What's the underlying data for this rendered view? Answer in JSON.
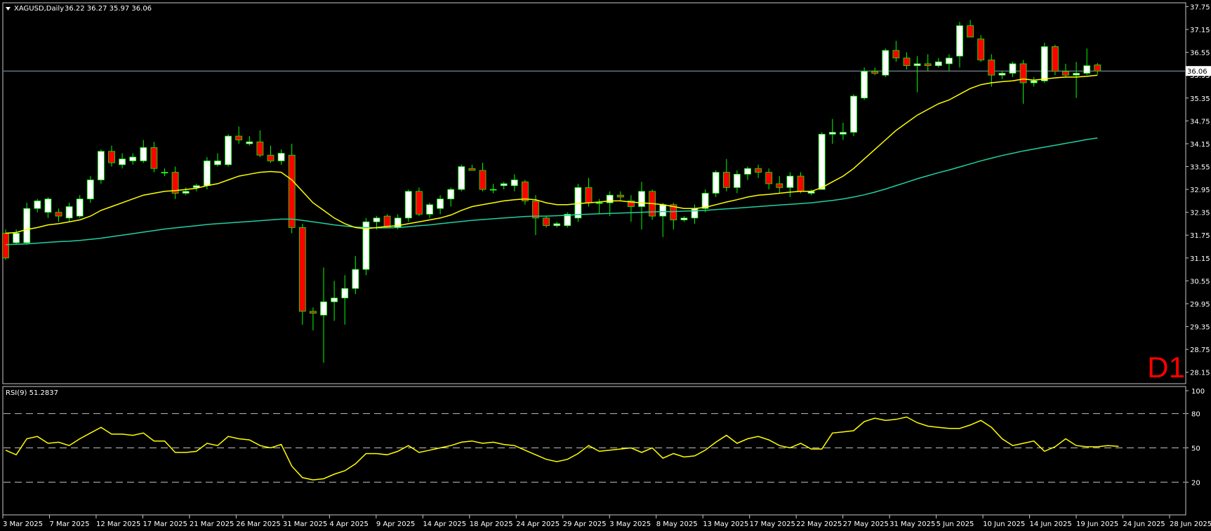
{
  "header": {
    "symbol_label": "XAGUSD,Daily",
    "ohlc_label": "36.22 36.27 35.97 36.06"
  },
  "timeframe_label": "D1",
  "current_price_label": "36.06",
  "rsi_header": "RSI(9) 51.2837",
  "colors": {
    "background": "#000000",
    "frame": "#c8c8c8",
    "bull_fill": "#ffffff",
    "bear_fill": "#ff0000",
    "wick": "#00ff00",
    "ma_fast": "#ffff00",
    "ma_slow": "#20d0a0",
    "rsi_line": "#ffff00",
    "level_line": "#bfbfbf",
    "price_line": "#8fa3b5",
    "timeframe": "#ff0000"
  },
  "chart_data": [
    {
      "type": "candlestick",
      "title": "XAGUSD,Daily",
      "ylim": [
        27.85,
        37.85
      ],
      "y_ticks": [
        "37.75",
        "37.15",
        "36.55",
        "35.95",
        "35.35",
        "34.75",
        "34.15",
        "33.55",
        "32.95",
        "32.35",
        "31.75",
        "31.15",
        "30.55",
        "29.95",
        "29.35",
        "28.75",
        "28.15"
      ],
      "x_tick_labels": [
        "3 Mar 2025",
        "7 Mar 2025",
        "12 Mar 2025",
        "17 Mar 2025",
        "21 Mar 2025",
        "26 Mar 2025",
        "31 Mar 2025",
        "4 Apr 2025",
        "9 Apr 2025",
        "14 Apr 2025",
        "18 Apr 2025",
        "24 Apr 2025",
        "29 Apr 2025",
        "3 May 2025",
        "8 May 2025",
        "13 May 2025",
        "17 May 2025",
        "22 May 2025",
        "27 May 2025",
        "31 May 2025",
        "5 Jun 2025",
        "10 Jun 2025",
        "14 Jun 2025",
        "19 Jun 2025",
        "24 Jun 2025",
        "28 Jun 2025"
      ],
      "current_price": 36.06,
      "candles": [
        {
          "o": 31.8,
          "h": 31.9,
          "l": 31.1,
          "c": 31.15
        },
        {
          "o": 31.55,
          "h": 31.9,
          "l": 31.5,
          "c": 31.8
        },
        {
          "o": 31.55,
          "h": 32.6,
          "l": 31.5,
          "c": 32.45
        },
        {
          "o": 32.45,
          "h": 32.7,
          "l": 32.35,
          "c": 32.65
        },
        {
          "o": 32.35,
          "h": 32.75,
          "l": 32.2,
          "c": 32.7
        },
        {
          "o": 32.35,
          "h": 32.45,
          "l": 32.1,
          "c": 32.25
        },
        {
          "o": 32.2,
          "h": 32.6,
          "l": 32.1,
          "c": 32.5
        },
        {
          "o": 32.25,
          "h": 32.8,
          "l": 32.2,
          "c": 32.7
        },
        {
          "o": 32.7,
          "h": 33.3,
          "l": 32.6,
          "c": 33.2
        },
        {
          "o": 33.2,
          "h": 34.0,
          "l": 33.1,
          "c": 33.95
        },
        {
          "o": 33.95,
          "h": 34.1,
          "l": 33.55,
          "c": 33.65
        },
        {
          "o": 33.6,
          "h": 33.9,
          "l": 33.5,
          "c": 33.75
        },
        {
          "o": 33.7,
          "h": 33.9,
          "l": 33.6,
          "c": 33.8
        },
        {
          "o": 33.7,
          "h": 34.25,
          "l": 33.65,
          "c": 34.05
        },
        {
          "o": 34.05,
          "h": 34.2,
          "l": 33.4,
          "c": 33.5
        },
        {
          "o": 33.4,
          "h": 33.5,
          "l": 33.3,
          "c": 33.4
        },
        {
          "o": 33.4,
          "h": 33.55,
          "l": 32.7,
          "c": 32.85
        },
        {
          "o": 32.85,
          "h": 33.0,
          "l": 32.8,
          "c": 32.9
        },
        {
          "o": 33.0,
          "h": 33.1,
          "l": 32.9,
          "c": 33.05
        },
        {
          "o": 33.05,
          "h": 33.8,
          "l": 32.95,
          "c": 33.7
        },
        {
          "o": 33.6,
          "h": 33.9,
          "l": 33.55,
          "c": 33.7
        },
        {
          "o": 33.6,
          "h": 34.4,
          "l": 33.55,
          "c": 34.35
        },
        {
          "o": 34.35,
          "h": 34.6,
          "l": 34.15,
          "c": 34.25
        },
        {
          "o": 34.15,
          "h": 34.35,
          "l": 34.1,
          "c": 34.2
        },
        {
          "o": 34.2,
          "h": 34.5,
          "l": 33.8,
          "c": 33.85
        },
        {
          "o": 33.85,
          "h": 34.1,
          "l": 33.65,
          "c": 33.7
        },
        {
          "o": 33.7,
          "h": 34.0,
          "l": 33.6,
          "c": 33.9
        },
        {
          "o": 33.85,
          "h": 34.15,
          "l": 31.8,
          "c": 31.95
        },
        {
          "o": 31.95,
          "h": 32.05,
          "l": 29.4,
          "c": 29.75
        },
        {
          "o": 29.75,
          "h": 29.85,
          "l": 29.25,
          "c": 29.7
        },
        {
          "o": 29.65,
          "h": 30.9,
          "l": 28.4,
          "c": 30.0
        },
        {
          "o": 30.0,
          "h": 30.55,
          "l": 29.5,
          "c": 30.1
        },
        {
          "o": 30.1,
          "h": 30.7,
          "l": 29.4,
          "c": 30.35
        },
        {
          "o": 30.35,
          "h": 31.2,
          "l": 30.2,
          "c": 30.85
        },
        {
          "o": 30.85,
          "h": 32.2,
          "l": 30.7,
          "c": 32.1
        },
        {
          "o": 32.1,
          "h": 32.25,
          "l": 31.9,
          "c": 32.2
        },
        {
          "o": 32.25,
          "h": 32.3,
          "l": 31.95,
          "c": 31.95
        },
        {
          "o": 31.95,
          "h": 32.3,
          "l": 31.9,
          "c": 32.2
        },
        {
          "o": 32.2,
          "h": 32.95,
          "l": 32.1,
          "c": 32.9
        },
        {
          "o": 32.9,
          "h": 33.0,
          "l": 32.25,
          "c": 32.3
        },
        {
          "o": 32.3,
          "h": 32.6,
          "l": 32.2,
          "c": 32.55
        },
        {
          "o": 32.45,
          "h": 32.8,
          "l": 32.3,
          "c": 32.7
        },
        {
          "o": 32.7,
          "h": 33.0,
          "l": 32.5,
          "c": 32.95
        },
        {
          "o": 32.95,
          "h": 33.6,
          "l": 32.9,
          "c": 33.55
        },
        {
          "o": 33.5,
          "h": 33.6,
          "l": 33.45,
          "c": 33.45
        },
        {
          "o": 33.45,
          "h": 33.65,
          "l": 32.9,
          "c": 32.95
        },
        {
          "o": 32.95,
          "h": 33.1,
          "l": 32.85,
          "c": 32.95
        },
        {
          "o": 33.05,
          "h": 33.15,
          "l": 32.95,
          "c": 33.1
        },
        {
          "o": 33.05,
          "h": 33.35,
          "l": 32.9,
          "c": 33.2
        },
        {
          "o": 33.15,
          "h": 33.2,
          "l": 32.55,
          "c": 32.65
        },
        {
          "o": 32.65,
          "h": 32.8,
          "l": 31.75,
          "c": 32.2
        },
        {
          "o": 32.2,
          "h": 32.25,
          "l": 31.95,
          "c": 32.0
        },
        {
          "o": 32.0,
          "h": 32.1,
          "l": 31.95,
          "c": 32.05
        },
        {
          "o": 32.0,
          "h": 32.35,
          "l": 31.95,
          "c": 32.3
        },
        {
          "o": 32.2,
          "h": 33.1,
          "l": 32.1,
          "c": 33.0
        },
        {
          "o": 33.0,
          "h": 33.25,
          "l": 32.5,
          "c": 32.6
        },
        {
          "o": 32.6,
          "h": 32.7,
          "l": 32.3,
          "c": 32.6
        },
        {
          "o": 32.6,
          "h": 32.9,
          "l": 32.25,
          "c": 32.8
        },
        {
          "o": 32.8,
          "h": 32.9,
          "l": 32.65,
          "c": 32.75
        },
        {
          "o": 32.65,
          "h": 32.8,
          "l": 32.1,
          "c": 32.5
        },
        {
          "o": 32.5,
          "h": 33.15,
          "l": 31.9,
          "c": 32.9
        },
        {
          "o": 32.9,
          "h": 32.95,
          "l": 32.15,
          "c": 32.25
        },
        {
          "o": 32.25,
          "h": 32.6,
          "l": 31.7,
          "c": 32.55
        },
        {
          "o": 32.55,
          "h": 32.6,
          "l": 31.9,
          "c": 32.15
        },
        {
          "o": 32.15,
          "h": 32.25,
          "l": 32.1,
          "c": 32.2
        },
        {
          "o": 32.2,
          "h": 32.55,
          "l": 32.05,
          "c": 32.45
        },
        {
          "o": 32.45,
          "h": 32.95,
          "l": 32.35,
          "c": 32.85
        },
        {
          "o": 32.85,
          "h": 33.45,
          "l": 32.75,
          "c": 33.4
        },
        {
          "o": 33.4,
          "h": 33.75,
          "l": 32.9,
          "c": 33.0
        },
        {
          "o": 33.0,
          "h": 33.45,
          "l": 32.85,
          "c": 33.35
        },
        {
          "o": 33.35,
          "h": 33.55,
          "l": 33.2,
          "c": 33.5
        },
        {
          "o": 33.5,
          "h": 33.6,
          "l": 33.25,
          "c": 33.4
        },
        {
          "o": 33.4,
          "h": 33.5,
          "l": 32.95,
          "c": 33.1
        },
        {
          "o": 33.1,
          "h": 33.3,
          "l": 32.85,
          "c": 33.0
        },
        {
          "o": 33.0,
          "h": 33.4,
          "l": 32.75,
          "c": 33.3
        },
        {
          "o": 33.3,
          "h": 33.4,
          "l": 32.85,
          "c": 32.9
        },
        {
          "o": 32.85,
          "h": 32.95,
          "l": 32.8,
          "c": 32.9
        },
        {
          "o": 32.95,
          "h": 34.45,
          "l": 32.95,
          "c": 34.4
        },
        {
          "o": 34.4,
          "h": 34.8,
          "l": 34.15,
          "c": 34.45
        },
        {
          "o": 34.4,
          "h": 34.7,
          "l": 34.25,
          "c": 34.45
        },
        {
          "o": 34.45,
          "h": 35.45,
          "l": 34.35,
          "c": 35.4
        },
        {
          "o": 35.35,
          "h": 36.15,
          "l": 35.3,
          "c": 36.05
        },
        {
          "o": 36.05,
          "h": 36.15,
          "l": 35.95,
          "c": 36.0
        },
        {
          "o": 35.95,
          "h": 36.65,
          "l": 35.9,
          "c": 36.6
        },
        {
          "o": 36.6,
          "h": 36.85,
          "l": 36.3,
          "c": 36.4
        },
        {
          "o": 36.4,
          "h": 36.55,
          "l": 36.1,
          "c": 36.2
        },
        {
          "o": 36.2,
          "h": 36.45,
          "l": 35.5,
          "c": 36.25
        },
        {
          "o": 36.25,
          "h": 36.5,
          "l": 36.05,
          "c": 36.2
        },
        {
          "o": 36.2,
          "h": 36.4,
          "l": 36.15,
          "c": 36.3
        },
        {
          "o": 36.25,
          "h": 36.5,
          "l": 36.05,
          "c": 36.4
        },
        {
          "o": 36.45,
          "h": 37.35,
          "l": 36.15,
          "c": 37.25
        },
        {
          "o": 37.25,
          "h": 37.4,
          "l": 36.95,
          "c": 36.95
        },
        {
          "o": 36.9,
          "h": 37.0,
          "l": 36.3,
          "c": 36.35
        },
        {
          "o": 36.35,
          "h": 36.5,
          "l": 35.65,
          "c": 35.95
        },
        {
          "o": 35.95,
          "h": 36.05,
          "l": 35.85,
          "c": 36.0
        },
        {
          "o": 36.0,
          "h": 36.3,
          "l": 35.9,
          "c": 36.25
        },
        {
          "o": 36.25,
          "h": 36.35,
          "l": 35.2,
          "c": 35.75
        },
        {
          "o": 35.75,
          "h": 35.9,
          "l": 35.65,
          "c": 35.8
        },
        {
          "o": 35.8,
          "h": 36.8,
          "l": 35.75,
          "c": 36.7
        },
        {
          "o": 36.7,
          "h": 36.75,
          "l": 35.95,
          "c": 36.05
        },
        {
          "o": 36.05,
          "h": 36.25,
          "l": 35.9,
          "c": 35.95
        },
        {
          "o": 35.95,
          "h": 36.3,
          "l": 35.35,
          "c": 36.0
        },
        {
          "o": 36.0,
          "h": 36.65,
          "l": 35.95,
          "c": 36.2
        },
        {
          "o": 36.22,
          "h": 36.27,
          "l": 35.97,
          "c": 36.06
        }
      ],
      "ma_fast": [
        31.8,
        31.82,
        31.9,
        31.95,
        32.02,
        32.05,
        32.1,
        32.15,
        32.25,
        32.4,
        32.5,
        32.6,
        32.7,
        32.8,
        32.85,
        32.9,
        32.92,
        32.95,
        32.98,
        33.05,
        33.1,
        33.2,
        33.3,
        33.35,
        33.4,
        33.42,
        33.4,
        33.2,
        32.9,
        32.6,
        32.4,
        32.2,
        32.05,
        31.95,
        31.92,
        31.95,
        31.98,
        32.0,
        32.05,
        32.1,
        32.15,
        32.2,
        32.28,
        32.4,
        32.5,
        32.55,
        32.6,
        32.65,
        32.68,
        32.7,
        32.68,
        32.6,
        32.55,
        32.55,
        32.58,
        32.6,
        32.62,
        32.65,
        32.65,
        32.62,
        32.6,
        32.58,
        32.55,
        32.5,
        32.45,
        32.45,
        32.48,
        32.55,
        32.62,
        32.68,
        32.75,
        32.8,
        32.82,
        32.85,
        32.88,
        32.9,
        32.9,
        33.0,
        33.15,
        33.3,
        33.5,
        33.75,
        34.0,
        34.25,
        34.5,
        34.7,
        34.9,
        35.05,
        35.2,
        35.3,
        35.45,
        35.6,
        35.7,
        35.75,
        35.78,
        35.8,
        35.85,
        35.82,
        35.85,
        35.88,
        35.9,
        35.9,
        35.92,
        35.95
      ],
      "ma_slow": [
        31.5,
        31.51,
        31.52,
        31.54,
        31.56,
        31.58,
        31.59,
        31.61,
        31.64,
        31.67,
        31.71,
        31.75,
        31.79,
        31.83,
        31.87,
        31.91,
        31.94,
        31.97,
        32.0,
        32.03,
        32.05,
        32.07,
        32.09,
        32.11,
        32.13,
        32.15,
        32.17,
        32.17,
        32.14,
        32.1,
        32.06,
        32.02,
        31.99,
        31.96,
        31.95,
        31.94,
        31.94,
        31.95,
        31.97,
        32.0,
        32.02,
        32.05,
        32.08,
        32.11,
        32.14,
        32.16,
        32.18,
        32.2,
        32.22,
        32.24,
        32.25,
        32.25,
        32.26,
        32.27,
        32.29,
        32.3,
        32.31,
        32.32,
        32.33,
        32.34,
        32.35,
        32.36,
        32.37,
        32.37,
        32.38,
        32.39,
        32.4,
        32.42,
        32.44,
        32.46,
        32.48,
        32.5,
        32.52,
        32.54,
        32.56,
        32.58,
        32.6,
        32.63,
        32.66,
        32.7,
        32.75,
        32.81,
        32.88,
        32.96,
        33.05,
        33.14,
        33.23,
        33.31,
        33.39,
        33.46,
        33.54,
        33.62,
        33.7,
        33.77,
        33.84,
        33.9,
        33.96,
        34.01,
        34.06,
        34.11,
        34.16,
        34.21,
        34.26,
        34.3
      ]
    },
    {
      "type": "line",
      "title": "RSI(9) 51.2837",
      "ylim": [
        0,
        100
      ],
      "y_ticks": [
        "100",
        "80",
        "50",
        "20"
      ],
      "levels": [
        80,
        50,
        20
      ],
      "series": [
        {
          "values": [
            48,
            44,
            58,
            60,
            54,
            55,
            52,
            58,
            63,
            68,
            62,
            62,
            61,
            63,
            56,
            56,
            46,
            46,
            47,
            54,
            52,
            60,
            58,
            57,
            52,
            50,
            53,
            34,
            24,
            22,
            23,
            27,
            30,
            36,
            45,
            45,
            44,
            47,
            52,
            46,
            48,
            50,
            52,
            55,
            56,
            54,
            55,
            53,
            52,
            48,
            44,
            40,
            38,
            40,
            45,
            52,
            47,
            48,
            49,
            50,
            46,
            50,
            41,
            45,
            42,
            43,
            48,
            55,
            61,
            54,
            58,
            60,
            57,
            52,
            50,
            54,
            49,
            49,
            63,
            64,
            65,
            73,
            76,
            74,
            75,
            77,
            72,
            69,
            68,
            67,
            67,
            70,
            74,
            68,
            58,
            52,
            54,
            56,
            47,
            51,
            58,
            52,
            51,
            51,
            52,
            51.28
          ]
        }
      ]
    }
  ]
}
